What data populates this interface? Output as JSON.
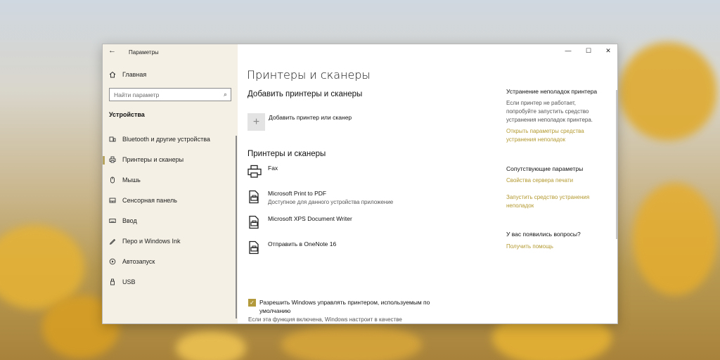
{
  "window": {
    "title": "Параметры",
    "back_icon": "back-arrow-icon",
    "controls": {
      "minimize": "—",
      "maximize": "☐",
      "close": "✕"
    }
  },
  "sidebar": {
    "home_label": "Главная",
    "search_placeholder": "Найти параметр",
    "section_label": "Устройства",
    "items": [
      {
        "label": "Bluetooth и другие устройства",
        "icon": "bluetooth-devices-icon"
      },
      {
        "label": "Принтеры и сканеры",
        "icon": "printer-icon",
        "selected": true
      },
      {
        "label": "Мышь",
        "icon": "mouse-icon"
      },
      {
        "label": "Сенсорная панель",
        "icon": "touchpad-icon"
      },
      {
        "label": "Ввод",
        "icon": "keyboard-icon"
      },
      {
        "label": "Перо и Windows Ink",
        "icon": "pen-icon"
      },
      {
        "label": "Автозапуск",
        "icon": "autoplay-icon"
      },
      {
        "label": "USB",
        "icon": "usb-icon"
      }
    ]
  },
  "main": {
    "title": "Принтеры и сканеры",
    "add_section_title": "Добавить принтеры и сканеры",
    "add_button_label": "Добавить принтер или сканер",
    "printers_section_title": "Принтеры и сканеры",
    "printers": [
      {
        "name": "Fax",
        "description": "",
        "icon": "fax-printer-icon"
      },
      {
        "name": "Microsoft Print to PDF",
        "description": "Доступное для данного устройства приложение",
        "icon": "document-printer-icon"
      },
      {
        "name": "Microsoft XPS Document Writer",
        "description": "",
        "icon": "document-printer-icon"
      },
      {
        "name": "Отправить в OneNote 16",
        "description": "",
        "icon": "document-printer-icon"
      }
    ],
    "default_printer_checkbox": {
      "checked": true,
      "label": "Разрешить Windows управлять принтером, используемым по умолчанию",
      "description": "Если эта функция включена, Windows настроит в качестве"
    }
  },
  "right_panel": {
    "troubleshoot": {
      "heading": "Устранение неполадок принтера",
      "text": [
        "Если принтер не работает,",
        "попробуйте запустить средство",
        "устранения неполадок принтера."
      ],
      "link": [
        "Открыть параметры средства",
        "устранения неполадок"
      ]
    },
    "related": {
      "heading": "Сопутствующие параметры",
      "link1": "Свойства сервера печати",
      "link2": [
        "Запустить средство устранения",
        "неполадок"
      ]
    },
    "questions": {
      "heading": "У вас появились вопросы?",
      "link": "Получить помощь"
    },
    "link_color": "#b3992f"
  },
  "colors": {
    "accent": "#b39a3c"
  }
}
